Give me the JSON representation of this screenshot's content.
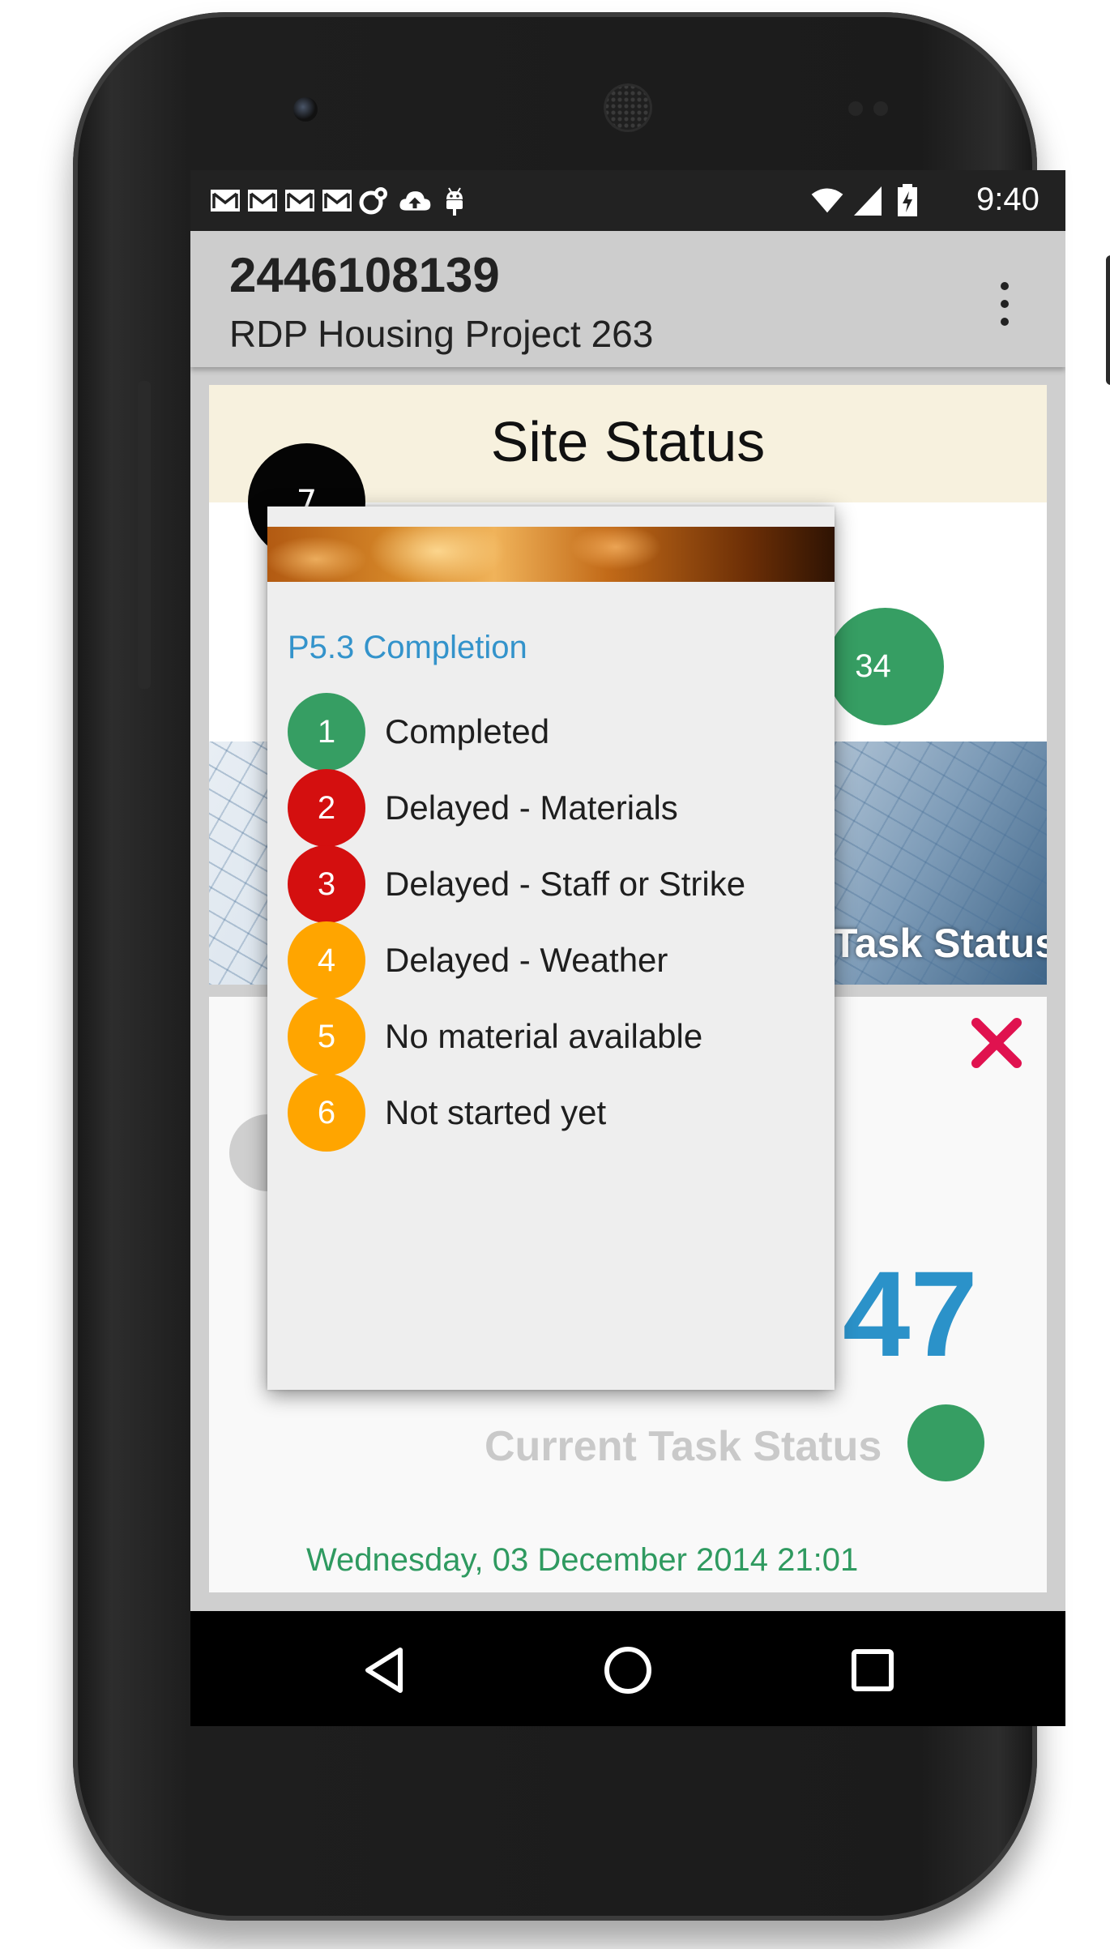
{
  "status_bar": {
    "time": "9:40",
    "icons": [
      "gmail-icon",
      "gmail-icon",
      "gmail-icon",
      "gmail-icon",
      "sync-icon",
      "cloud-upload-icon",
      "android-debug-icon",
      "wifi-icon",
      "signal-icon",
      "battery-charging-icon"
    ]
  },
  "app_bar": {
    "title": "2446108139",
    "subtitle": "RDP Housing Project 263",
    "overflow_icon": "more-vert-icon"
  },
  "site_card": {
    "title": "Site Status",
    "black_badge": "7",
    "green_badge": "34",
    "image_caption": "Task Status",
    "colors": {
      "header_bg": "#f7f1de",
      "green": "#369e63"
    }
  },
  "task_card": {
    "big_number": "47",
    "status_label": "Current Task Status",
    "timestamp": "Wednesday, 03 December 2014 21:01",
    "close_icon": "close-icon",
    "colors": {
      "number": "#2b92c9",
      "timestamp": "#2f9a60",
      "close": "#e0124f"
    }
  },
  "popup": {
    "title": "P5.3 Completion",
    "items": [
      {
        "number": "1",
        "label": "Completed",
        "color": "#369e63"
      },
      {
        "number": "2",
        "label": "Delayed - Materials",
        "color": "#d40f0f"
      },
      {
        "number": "3",
        "label": "Delayed - Staff or Strike",
        "color": "#d40f0f"
      },
      {
        "number": "4",
        "label": "Delayed - Weather",
        "color": "#ffa500"
      },
      {
        "number": "5",
        "label": "No material available",
        "color": "#ffa500"
      },
      {
        "number": "6",
        "label": "Not started yet",
        "color": "#ffa500"
      }
    ]
  },
  "nav_bar": {
    "back": "back-icon",
    "home": "home-icon",
    "recents": "recents-icon"
  }
}
